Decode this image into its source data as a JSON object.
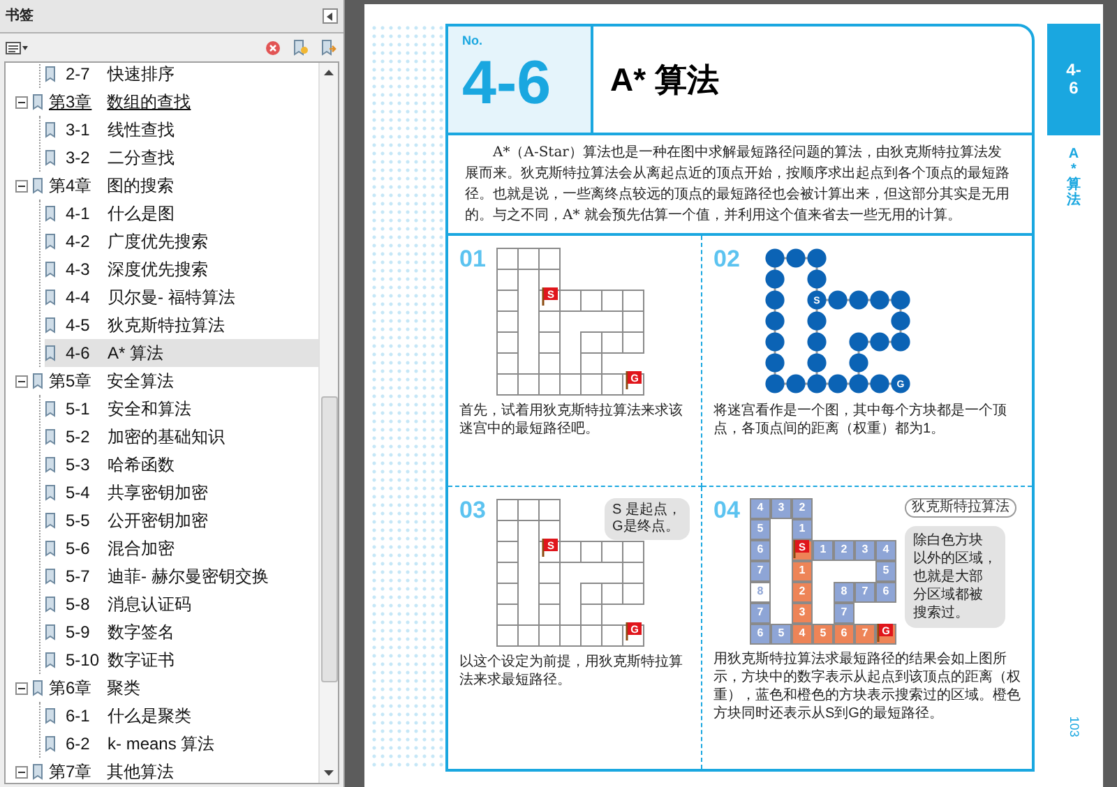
{
  "sidebar": {
    "title": "书签",
    "tree": {
      "continued_children": [
        {
          "number": "2-7",
          "title": "快速排序",
          "selected": false
        }
      ],
      "chapters": [
        {
          "number": "第3章",
          "title": "数组的查找",
          "expanded": true,
          "hovered": true,
          "children": [
            {
              "number": "3-1",
              "title": "线性查找",
              "selected": false
            },
            {
              "number": "3-2",
              "title": "二分查找",
              "selected": false
            }
          ]
        },
        {
          "number": "第4章",
          "title": "图的搜索",
          "expanded": true,
          "hovered": false,
          "children": [
            {
              "number": "4-1",
              "title": "什么是图",
              "selected": false
            },
            {
              "number": "4-2",
              "title": "广度优先搜索",
              "selected": false
            },
            {
              "number": "4-3",
              "title": "深度优先搜索",
              "selected": false
            },
            {
              "number": "4-4",
              "title": "贝尔曼- 福特算法",
              "selected": false
            },
            {
              "number": "4-5",
              "title": "狄克斯特拉算法",
              "selected": false
            },
            {
              "number": "4-6",
              "title": "A* 算法",
              "selected": true
            }
          ]
        },
        {
          "number": "第5章",
          "title": "安全算法",
          "expanded": true,
          "hovered": false,
          "children": [
            {
              "number": "5-1",
              "title": "安全和算法",
              "selected": false
            },
            {
              "number": "5-2",
              "title": "加密的基础知识",
              "selected": false
            },
            {
              "number": "5-3",
              "title": "哈希函数",
              "selected": false
            },
            {
              "number": "5-4",
              "title": "共享密钥加密",
              "selected": false
            },
            {
              "number": "5-5",
              "title": "公开密钥加密",
              "selected": false
            },
            {
              "number": "5-6",
              "title": "混合加密",
              "selected": false
            },
            {
              "number": "5-7",
              "title": "迪菲- 赫尔曼密钥交换",
              "selected": false
            },
            {
              "number": "5-8",
              "title": "消息认证码",
              "selected": false
            },
            {
              "number": "5-9",
              "title": "数字签名",
              "selected": false
            },
            {
              "number": "5-10",
              "title": "数字证书",
              "selected": false
            }
          ]
        },
        {
          "number": "第6章",
          "title": "聚类",
          "expanded": true,
          "hovered": false,
          "children": [
            {
              "number": "6-1",
              "title": "什么是聚类",
              "selected": false
            },
            {
              "number": "6-2",
              "title": "k- means 算法",
              "selected": false
            }
          ]
        },
        {
          "number": "第7章",
          "title": "其他算法",
          "expanded": true,
          "hovered": false
        }
      ]
    }
  },
  "page": {
    "section_label": "No.",
    "section_number": "4-6",
    "title": "A* 算法",
    "intro": "A*（A-Star）算法也是一种在图中求解最短路径问题的算法，由狄克斯特拉算法发展而来。狄克斯特拉算法会从离起点近的顶点开始，按顺序求出起点到各个顶点的最短路径。也就是说，一些离终点较远的顶点的最短路径也会被计算出来，但这部分其实是无用的。与之不同，A* 就会预先估算一个值，并利用这个值来省去一些无用的计算。",
    "panels": [
      {
        "number": "01",
        "kind": "maze",
        "start_label": "S",
        "goal_label": "G",
        "caption": "首先，试着用狄克斯特拉算法来求该迷宫中的最短路径吧。"
      },
      {
        "number": "02",
        "kind": "graph",
        "start_label": "S",
        "goal_label": "G",
        "caption": "将迷宫看作是一个图，其中每个方块都是一个顶点，各顶点间的距离（权重）都为1。"
      },
      {
        "number": "03",
        "kind": "maze",
        "start_label": "S",
        "goal_label": "G",
        "bubble": [
          "S 是起点，",
          "G是终点。"
        ],
        "caption": "以这个设定为前提，用狄克斯特拉算法来求最短路径。"
      },
      {
        "number": "04",
        "kind": "result",
        "tag": "狄克斯特拉算法",
        "bubble": [
          "除白色方块",
          "以外的区域，",
          "也就是大部",
          "分区域都被",
          "搜索过。"
        ],
        "grid": [
          [
            {
              "kind": "searched",
              "text": "4"
            },
            {
              "kind": "searched",
              "text": "3"
            },
            {
              "kind": "searched",
              "text": "2"
            },
            {
              "kind": "none"
            },
            {
              "kind": "none"
            },
            {
              "kind": "none"
            },
            {
              "kind": "none"
            }
          ],
          [
            {
              "kind": "searched",
              "text": "5"
            },
            {
              "kind": "blank"
            },
            {
              "kind": "searched",
              "text": "1"
            },
            {
              "kind": "none"
            },
            {
              "kind": "none"
            },
            {
              "kind": "none"
            },
            {
              "kind": "none"
            }
          ],
          [
            {
              "kind": "searched",
              "text": "6"
            },
            {
              "kind": "blank"
            },
            {
              "kind": "path",
              "flag": "S"
            },
            {
              "kind": "searched",
              "text": "1"
            },
            {
              "kind": "searched",
              "text": "2"
            },
            {
              "kind": "searched",
              "text": "3"
            },
            {
              "kind": "searched",
              "text": "4"
            }
          ],
          [
            {
              "kind": "searched",
              "text": "7"
            },
            {
              "kind": "blank"
            },
            {
              "kind": "path",
              "text": "1"
            },
            {
              "kind": "blank"
            },
            {
              "kind": "blank"
            },
            {
              "kind": "blank"
            },
            {
              "kind": "searched",
              "text": "5"
            }
          ],
          [
            {
              "kind": "unvisited",
              "text": "8"
            },
            {
              "kind": "blank"
            },
            {
              "kind": "path",
              "text": "2"
            },
            {
              "kind": "blank"
            },
            {
              "kind": "searched",
              "text": "8"
            },
            {
              "kind": "searched",
              "text": "7"
            },
            {
              "kind": "searched",
              "text": "6"
            }
          ],
          [
            {
              "kind": "searched",
              "text": "7"
            },
            {
              "kind": "blank"
            },
            {
              "kind": "path",
              "text": "3"
            },
            {
              "kind": "blank"
            },
            {
              "kind": "searched",
              "text": "7"
            },
            {
              "kind": "none"
            },
            {
              "kind": "none"
            }
          ],
          [
            {
              "kind": "searched",
              "text": "6"
            },
            {
              "kind": "searched",
              "text": "5"
            },
            {
              "kind": "path",
              "text": "4"
            },
            {
              "kind": "path",
              "text": "5"
            },
            {
              "kind": "path",
              "text": "6"
            },
            {
              "kind": "path",
              "text": "7"
            },
            {
              "kind": "path",
              "flag": "G"
            }
          ]
        ],
        "caption": "用狄克斯特拉算法求最短路径的结果会如上图所示，方块中的数字表示从起点到该顶点的距离（权重），蓝色和橙色的方块表示搜索过的区域。橙色方块同时还表示从S到G的最短路径。"
      }
    ],
    "side_tab": {
      "number": "4-6",
      "title": "A* 算法"
    },
    "page_number": "103"
  }
}
